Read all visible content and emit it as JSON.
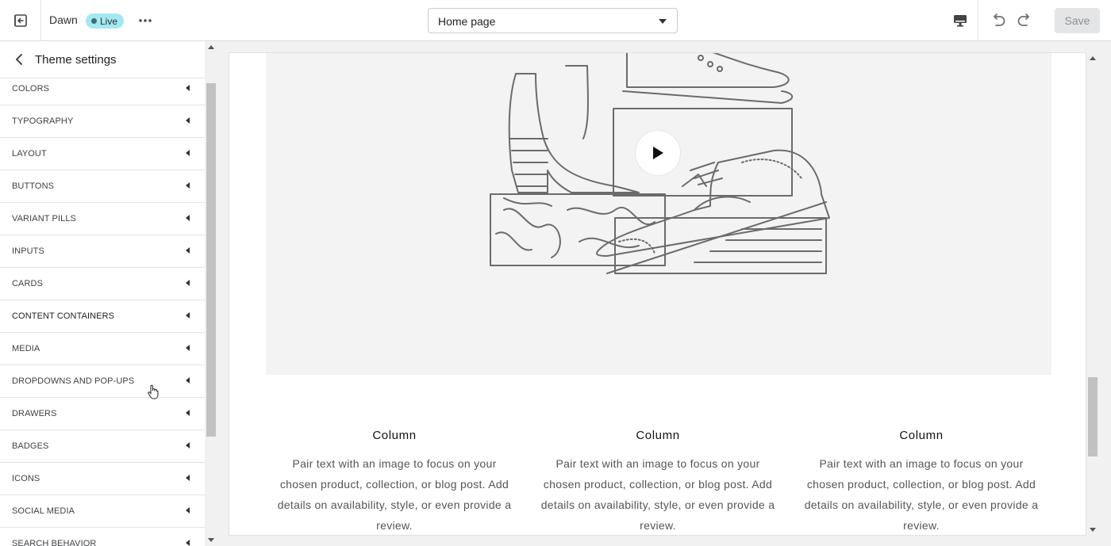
{
  "topbar": {
    "theme_name": "Dawn",
    "live_badge": "Live",
    "page_select": "Home page",
    "save_label": "Save"
  },
  "sidebar": {
    "title": "Theme settings",
    "items": [
      {
        "label": "COLORS"
      },
      {
        "label": "TYPOGRAPHY"
      },
      {
        "label": "LAYOUT"
      },
      {
        "label": "BUTTONS"
      },
      {
        "label": "VARIANT PILLS"
      },
      {
        "label": "INPUTS"
      },
      {
        "label": "CARDS"
      },
      {
        "label": "CONTENT CONTAINERS"
      },
      {
        "label": "MEDIA"
      },
      {
        "label": "DROPDOWNS AND POP-UPS"
      },
      {
        "label": "DRAWERS"
      },
      {
        "label": "BADGES"
      },
      {
        "label": "ICONS"
      },
      {
        "label": "SOCIAL MEDIA"
      },
      {
        "label": "SEARCH BEHAVIOR"
      }
    ]
  },
  "preview": {
    "columns": [
      {
        "title": "Column",
        "text": "Pair text with an image to focus on your chosen product, collection, or blog post. Add details on availability, style, or even provide a review."
      },
      {
        "title": "Column",
        "text": "Pair text with an image to focus on your chosen product, collection, or blog post. Add details on availability, style, or even provide a review."
      },
      {
        "title": "Column",
        "text": "Pair text with an image to focus on your chosen product, collection, or blog post. Add details on availability, style, or even provide a review."
      }
    ]
  },
  "colors": {
    "live_badge": "#a4e8f2",
    "save_disabled": "#e4e5e7",
    "media_background": "#f3f3f3"
  }
}
